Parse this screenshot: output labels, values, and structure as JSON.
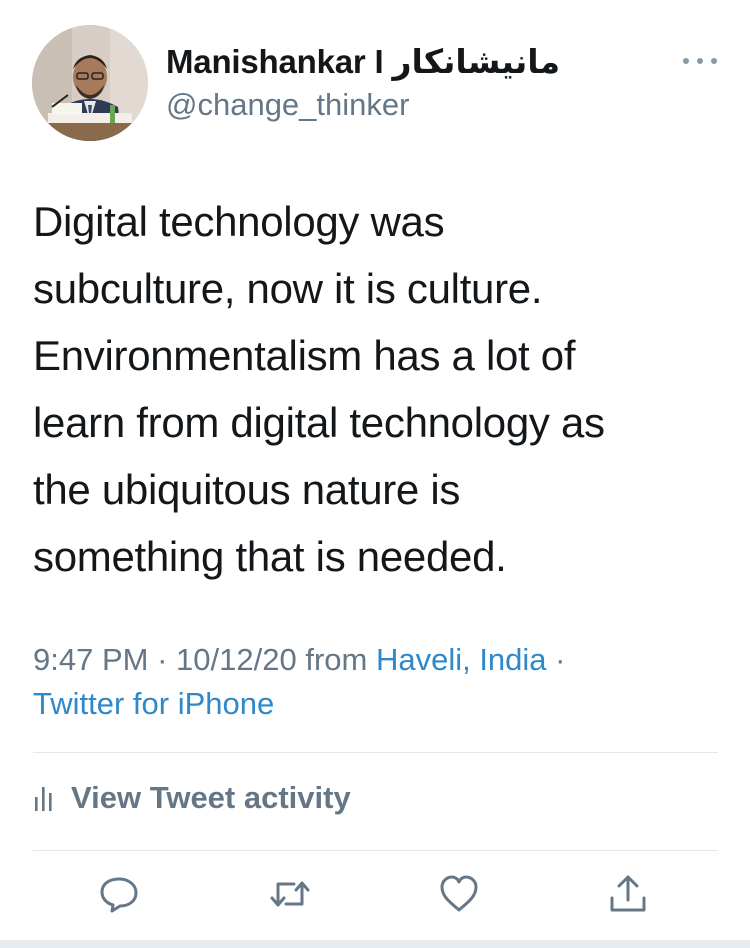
{
  "user": {
    "display_name": "Manishankar I مانیشانکار",
    "handle": "@change_thinker"
  },
  "tweet": {
    "text": "Digital technology was\nsubculture, now it is culture.\nEnvironmentalism has a lot of\nlearn from digital technology as\nthe ubiquitous nature is\nsomething that is needed.",
    "time": "9:47 PM",
    "date": "10/12/20",
    "from_word": "from",
    "location": "Haveli, India",
    "separator": "·",
    "source": "Twitter for iPhone"
  },
  "activity": {
    "label": "View Tweet activity"
  },
  "icons": {
    "more": "more-options-icon",
    "activity": "bar-chart-icon",
    "reply": "reply-icon",
    "retweet": "retweet-icon",
    "like": "heart-icon",
    "share": "share-icon"
  },
  "colors": {
    "text": "#14171a",
    "secondary": "#657786",
    "link": "#2f88c9",
    "icon": "#657786"
  }
}
